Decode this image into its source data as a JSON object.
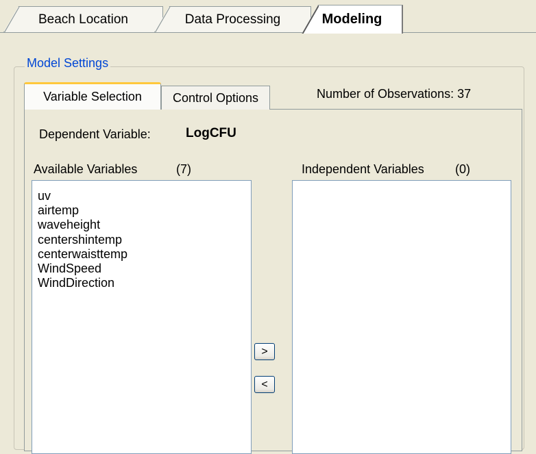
{
  "top_tabs": [
    {
      "label": "Beach Location",
      "selected": false
    },
    {
      "label": "Data Processing",
      "selected": false
    },
    {
      "label": "Modeling",
      "selected": true
    }
  ],
  "model_settings": {
    "group_title": "Model Settings",
    "inner_tabs": [
      {
        "label": "Variable Selection",
        "selected": true
      },
      {
        "label": "Control Options",
        "selected": false
      }
    ],
    "observations_text": "Number of Observations: 37",
    "dependent_label": "Dependent Variable:",
    "dependent_value": "LogCFU",
    "available": {
      "label": "Available Variables",
      "count": "(7)",
      "items": [
        "uv",
        "airtemp",
        "waveheight",
        "centershintemp",
        "centerwaisttemp",
        "WindSpeed",
        "WindDirection"
      ]
    },
    "independent": {
      "label": "Independent Variables",
      "count": "(0)",
      "items": []
    },
    "buttons": {
      "add": ">",
      "remove": "<"
    }
  },
  "colors": {
    "window_bg": "#ece9d8",
    "group_title": "#0046d5",
    "active_tab_accent": "#ffc83c",
    "list_border": "#7f9db9"
  }
}
